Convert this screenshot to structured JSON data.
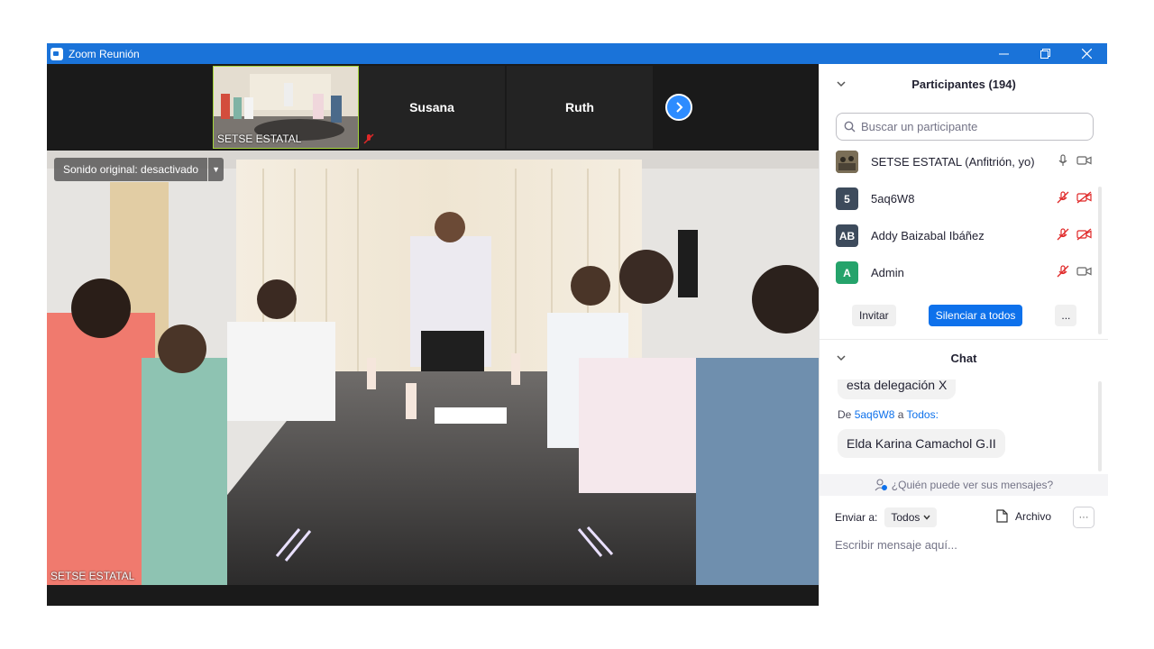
{
  "window": {
    "title": "Zoom Reunión"
  },
  "video": {
    "self_thumb_label": "SETSE ESTATAL",
    "thumb_names": [
      "Susana",
      "Ruth"
    ],
    "sound_label": "Sonido original: desactivado",
    "main_label": "SETSE ESTATAL"
  },
  "participants": {
    "title": "Participantes (194)",
    "search_placeholder": "Buscar un participante",
    "list": [
      {
        "initials": "",
        "name": "SETSE ESTATAL (Anfitrión, yo)",
        "color": "#6b6048",
        "mic": "on",
        "cam": "on"
      },
      {
        "initials": "5",
        "name": "5aq6W8",
        "color": "#3d4b5c",
        "mic": "muted",
        "cam": "off"
      },
      {
        "initials": "AB",
        "name": "Addy Baizabal Ibáñez",
        "color": "#3d4b5c",
        "mic": "muted",
        "cam": "off"
      },
      {
        "initials": "A",
        "name": "Admin",
        "color": "#25a36b",
        "mic": "muted",
        "cam": "on"
      }
    ],
    "invite_label": "Invitar",
    "mute_all_label": "Silenciar a todos",
    "more_label": "..."
  },
  "chat": {
    "title": "Chat",
    "prev_message": "esta delegación X",
    "meta_prefix": "De",
    "meta_sender": "5aq6W8",
    "meta_mid": "a",
    "meta_target": "Todos:",
    "last_message": "Elda Karina Camachol G.II",
    "who_can_see": "¿Quién puede ver sus mensajes?",
    "send_to_label": "Enviar a:",
    "send_to_value": "Todos",
    "file_label": "Archivo",
    "input_placeholder": "Escribir mensaje aquí..."
  },
  "colors": {
    "accent": "#0e71eb",
    "titlebar": "#1a73d9",
    "mute_red": "#e02828"
  }
}
